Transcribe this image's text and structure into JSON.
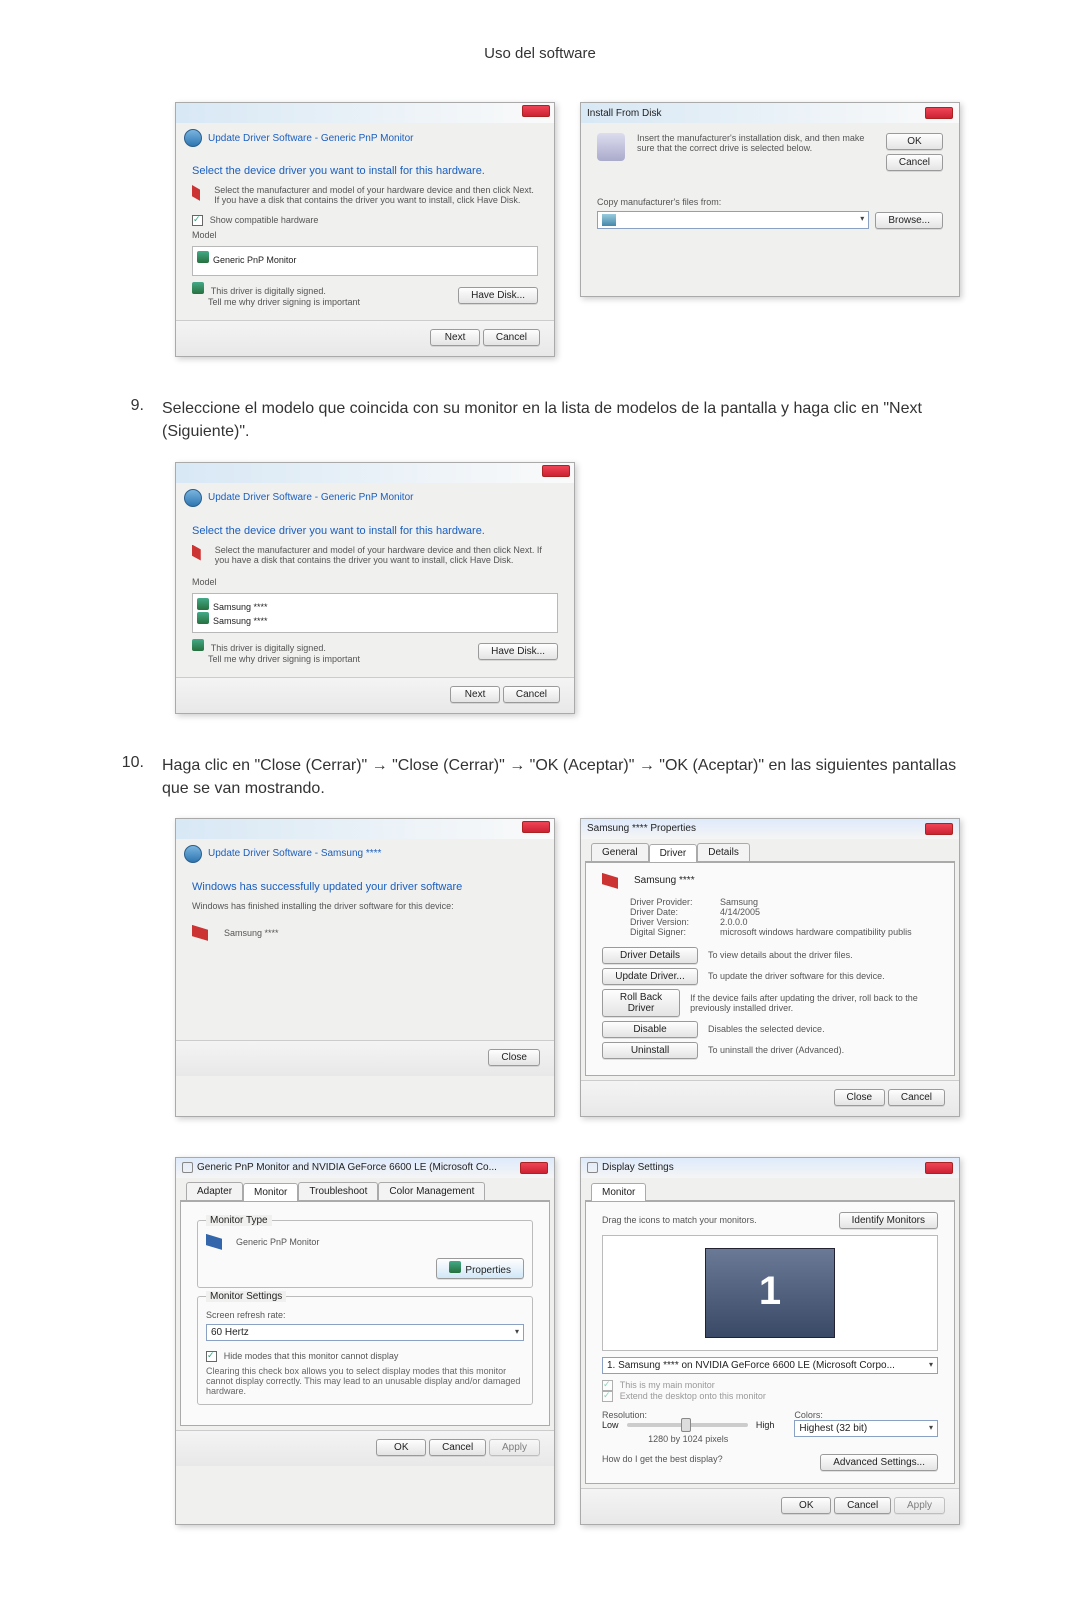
{
  "header": {
    "title": "Uso del software"
  },
  "step9": {
    "num": "9.",
    "text": "Seleccione el modelo que coincida con su monitor en la lista de modelos de la pantalla y haga clic en \"Next (Siguiente)\"."
  },
  "step10": {
    "num": "10.",
    "text": "Haga clic en \"Close (Cerrar)\" → \"Close (Cerrar)\" → \"OK (Aceptar)\" → \"OK (Aceptar)\" en las siguientes pantallas que se van mostrando."
  },
  "dialog_driver_select": {
    "title": "Update Driver Software - Generic PnP Monitor",
    "heading": "Select the device driver you want to install for this hardware.",
    "sub": "Select the manufacturer and model of your hardware device and then click Next. If you have a disk that contains the driver you want to install, click Have Disk.",
    "show_compat": "Show compatible hardware",
    "model_label": "Model",
    "model_row": "Generic PnP Monitor",
    "signed": "This driver is digitally signed.",
    "signed_link": "Tell me why driver signing is important",
    "have_disk": "Have Disk...",
    "next": "Next",
    "cancel": "Cancel"
  },
  "dialog_install_disk": {
    "title": "Install From Disk",
    "msg": "Insert the manufacturer's installation disk, and then make sure that the correct drive is selected below.",
    "ok": "OK",
    "cancel": "Cancel",
    "copy_label": "Copy manufacturer's files from:",
    "browse": "Browse..."
  },
  "dialog_driver_select2": {
    "title": "Update Driver Software - Generic PnP Monitor",
    "heading": "Select the device driver you want to install for this hardware.",
    "sub": "Select the manufacturer and model of your hardware device and then click Next. If you have a disk that contains the driver you want to install, click Have Disk.",
    "model_label": "Model",
    "model_row1": "Samsung ****",
    "model_row2": "Samsung ****",
    "signed": "This driver is digitally signed.",
    "signed_link": "Tell me why driver signing is important",
    "have_disk": "Have Disk...",
    "next": "Next",
    "cancel": "Cancel"
  },
  "dialog_closed": {
    "title": "Update Driver Software - Samsung ****",
    "heading": "Windows has successfully updated your driver software",
    "sub": "Windows has finished installing the driver software for this device:",
    "device": "Samsung ****",
    "close": "Close"
  },
  "dialog_props": {
    "title": "Samsung **** Properties",
    "tabs": {
      "general": "General",
      "driver": "Driver",
      "details": "Details"
    },
    "device_name": "Samsung ****",
    "rows": {
      "provider_l": "Driver Provider:",
      "provider_v": "Samsung",
      "date_l": "Driver Date:",
      "date_v": "4/14/2005",
      "version_l": "Driver Version:",
      "version_v": "2.0.0.0",
      "signer_l": "Digital Signer:",
      "signer_v": "microsoft windows hardware compatibility publis"
    },
    "btns": {
      "details": "Driver Details",
      "details_d": "To view details about the driver files.",
      "update": "Update Driver...",
      "update_d": "To update the driver software for this device.",
      "rollback": "Roll Back Driver",
      "rollback_d": "If the device fails after updating the driver, roll back to the previously installed driver.",
      "disable": "Disable",
      "disable_d": "Disables the selected device.",
      "uninstall": "Uninstall",
      "uninstall_d": "To uninstall the driver (Advanced)."
    },
    "close": "Close",
    "cancel": "Cancel"
  },
  "dialog_adapter": {
    "title": "Generic PnP Monitor and NVIDIA GeForce 6600 LE (Microsoft Co...",
    "tabs": {
      "adapter": "Adapter",
      "monitor": "Monitor",
      "troubleshoot": "Troubleshoot",
      "color": "Color Management"
    },
    "group_type": "Monitor Type",
    "type_val": "Generic PnP Monitor",
    "properties": "Properties",
    "group_settings": "Monitor Settings",
    "refresh_l": "Screen refresh rate:",
    "refresh_v": "60 Hertz",
    "hide_modes": "Hide modes that this monitor cannot display",
    "hide_desc": "Clearing this check box allows you to select display modes that this monitor cannot display correctly. This may lead to an unusable display and/or damaged hardware.",
    "ok": "OK",
    "cancel": "Cancel",
    "apply": "Apply"
  },
  "dialog_display": {
    "title": "Display Settings",
    "tab": "Monitor",
    "drag_label": "Drag the icons to match your monitors.",
    "identify": "Identify Monitors",
    "mon_num": "1",
    "monitor_combo": "1. Samsung **** on NVIDIA GeForce 6600 LE (Microsoft Corpo...",
    "main_check": "This is my main monitor",
    "extend_check": "Extend the desktop onto this monitor",
    "res_l": "Resolution:",
    "colors_l": "Colors:",
    "low": "Low",
    "high": "High",
    "res_val": "1280 by 1024 pixels",
    "colors_v": "Highest (32 bit)",
    "best_link": "How do I get the best display?",
    "adv": "Advanced Settings...",
    "ok": "OK",
    "cancel": "Cancel",
    "apply": "Apply"
  }
}
